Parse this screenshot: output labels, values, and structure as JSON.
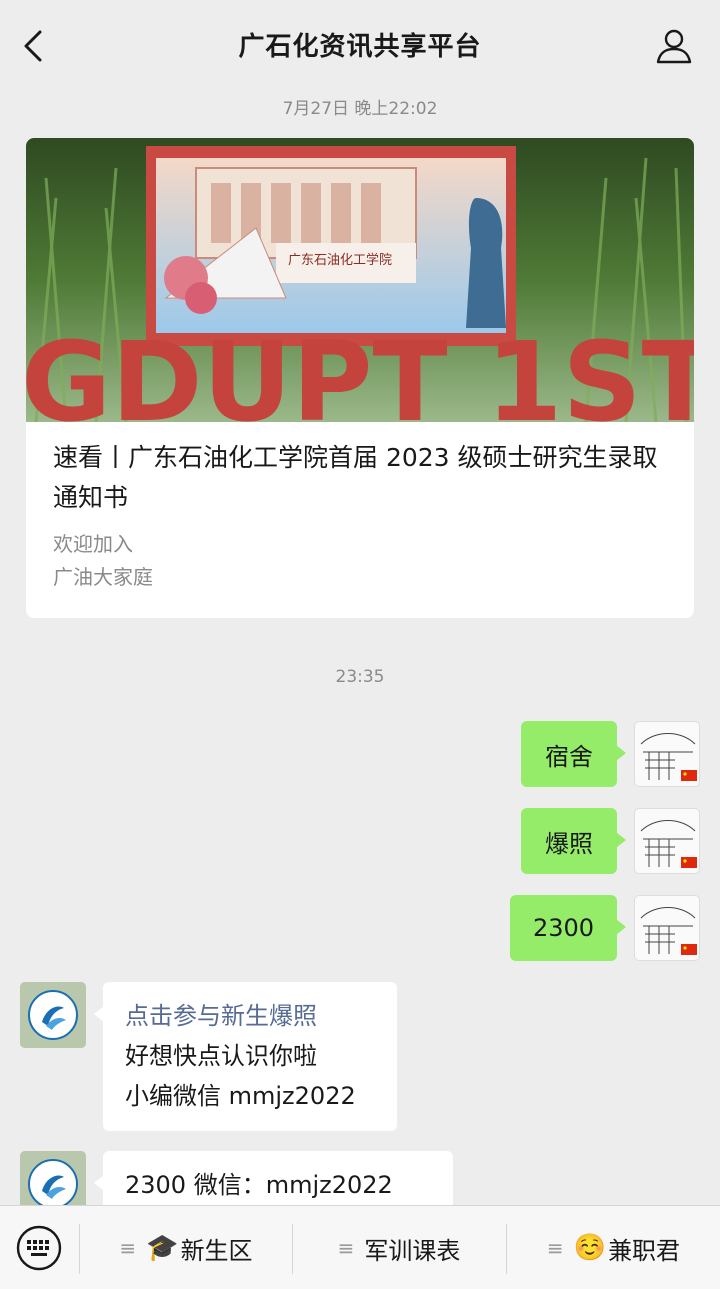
{
  "header": {
    "title": "广石化资讯共享平台"
  },
  "timestamps": {
    "first": "7月27日 晚上22:02",
    "second": "23:35"
  },
  "article": {
    "title": "速看丨广东石油化工学院首届 2023 级硕士研究生录取通知书",
    "desc_line1": "欢迎加入",
    "desc_line2": "广油大家庭",
    "cover_text": "GDUPT 1ST"
  },
  "messages": {
    "user": [
      {
        "text": "宿舍"
      },
      {
        "text": "爆照"
      },
      {
        "text": "2300"
      }
    ],
    "bot": [
      {
        "link": "点击参与新生爆照",
        "line2": "好想快点认识你啦",
        "line3": "小编微信 mmjz2022"
      },
      {
        "line1": "2300 微信：mmjz2022"
      }
    ]
  },
  "menu": {
    "items": [
      {
        "label": "新生区",
        "icon": "graduation-cap-icon",
        "emoji": "🎓"
      },
      {
        "label": "军训课表"
      },
      {
        "label": "兼职君",
        "icon": "smiling-face-icon",
        "emoji": "☺️"
      }
    ]
  },
  "colors": {
    "background": "#ededed",
    "user_bubble": "#95ec69",
    "bot_bubble": "#ffffff",
    "link": "#576b95",
    "muted_text": "#8a8a8a"
  }
}
